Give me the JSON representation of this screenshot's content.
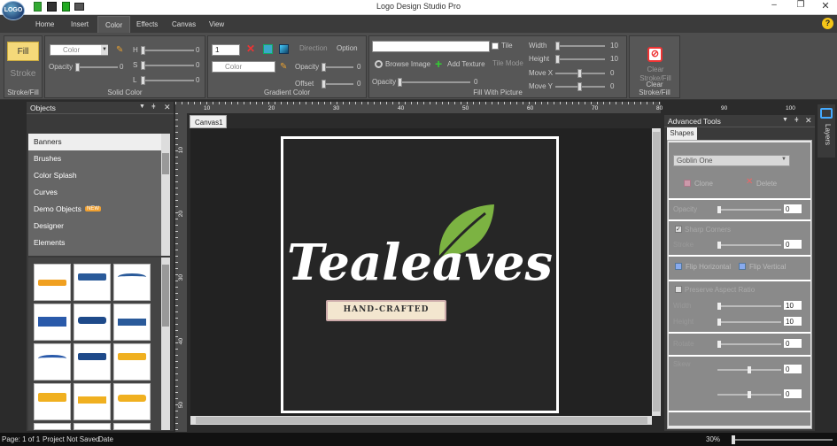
{
  "app": {
    "title": "Logo Design Studio Pro"
  },
  "tabs": [
    "Home",
    "Insert",
    "Color",
    "Effects",
    "Canvas",
    "View"
  ],
  "ribbon": {
    "stroke_fill": {
      "fill": "Fill",
      "stroke": "Stroke",
      "label": "Stroke/Fill"
    },
    "solid_color": {
      "combo": "Color",
      "opacity": "Opacity",
      "opacity_val": "0",
      "h": "H",
      "s": "S",
      "l": "L",
      "h_val": "0",
      "s_val": "0",
      "l_val": "0",
      "label": "Solid Color"
    },
    "gradient": {
      "count": "1",
      "combo": "Color",
      "direction": "Direction",
      "option": "Option",
      "opacity": "Opacity",
      "opacity_val": "0",
      "offset": "Offset",
      "offset_val": "0",
      "label": "Gradient Color"
    },
    "picture": {
      "tile": "Tile",
      "browse": "Browse Image",
      "add_texture": "Add Texture",
      "tile_mode": "Tile Mode",
      "opacity": "Opacity",
      "opacity_val": "0",
      "width": "Width",
      "width_val": "10",
      "height": "Height",
      "height_val": "10",
      "movex": "Move X",
      "movex_val": "0",
      "movey": "Move Y",
      "movey_val": "0",
      "label": "Fill With Picture"
    },
    "clear": {
      "btn": "Clear Stroke/Fill",
      "label": "Clear Stroke/Fill"
    }
  },
  "objects": {
    "title": "Objects",
    "items": [
      "Banners",
      "Brushes",
      "Color Splash",
      "Curves",
      "Demo Objects",
      "Designer",
      "Elements"
    ],
    "new_badge": "NEW"
  },
  "canvas": {
    "tab": "Canvas1",
    "ruler_h": [
      "10",
      "20",
      "30",
      "40",
      "50",
      "60",
      "70",
      "80",
      "90",
      "100"
    ],
    "ruler_v": [
      "10",
      "20",
      "30",
      "40",
      "50"
    ],
    "logo_title": "Tealeaves",
    "logo_sub": "HAND-CRAFTED"
  },
  "advanced": {
    "title": "Advanced Tools",
    "tab": "Shapes",
    "side_tab": "Layers",
    "shape_combo": "Goblin One",
    "clone": "Clone",
    "delete": "Delete",
    "opacity": "Opacity",
    "opacity_val": "0",
    "sharp": "Sharp Corners",
    "stroke": "Stroke",
    "stroke_val": "0",
    "flip_h": "Flip Horizontal",
    "flip_v": "Flip Vertical",
    "preserve": "Preserve Aspect Ratio",
    "width": "Width",
    "width_val": "10",
    "height": "Height",
    "height_val": "10",
    "rotate": "Rotate",
    "rotate_val": "0",
    "skew": "Skew",
    "skew1_val": "0",
    "skew2_val": "0"
  },
  "status": {
    "page": "Page: 1 of 1",
    "saved": "Project Not Saved",
    "date": "Date",
    "zoom": "30%"
  },
  "colors": {
    "fill_btn": "#f5d97a",
    "leaf": "#7cb342",
    "logo_bg": "#262626"
  }
}
